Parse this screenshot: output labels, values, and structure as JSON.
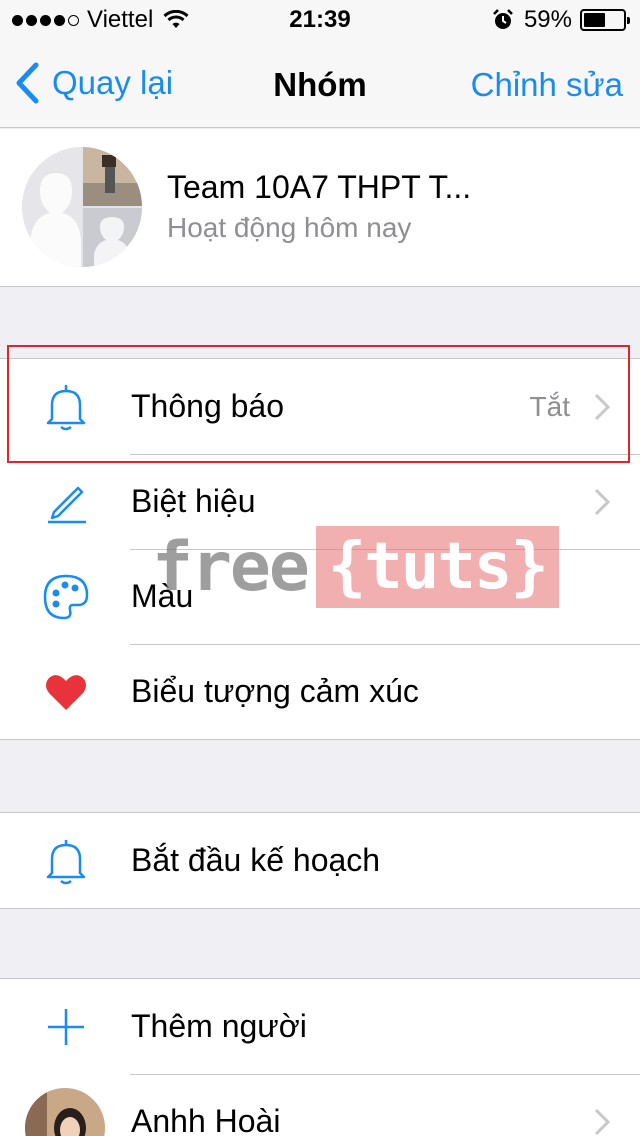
{
  "status_bar": {
    "carrier": "Viettel",
    "time": "21:39",
    "battery_percent": "59%",
    "battery_level": 0.59,
    "signal_bars_filled": 4,
    "signal_bars_total": 5
  },
  "nav": {
    "back_label": "Quay lại",
    "title": "Nhóm",
    "edit_label": "Chỉnh sửa"
  },
  "group": {
    "name": "Team 10A7 THPT T...",
    "status": "Hoạt động hôm nay"
  },
  "settings": {
    "notifications_label": "Thông báo",
    "notifications_value": "Tắt",
    "nickname_label": "Biệt hiệu",
    "color_label": "Màu",
    "emoji_label": "Biểu tượng cảm xúc"
  },
  "plans": {
    "start_plan_label": "Bắt đầu kế hoạch"
  },
  "people": {
    "add_people_label": "Thêm người",
    "members": [
      {
        "name": "Anhh Hoài"
      }
    ]
  },
  "watermark": {
    "left": "free",
    "right": "{tuts}"
  },
  "colors": {
    "accent": "#1a8cf0",
    "highlight_border": "#e0262a",
    "heart": "#e8333a"
  }
}
